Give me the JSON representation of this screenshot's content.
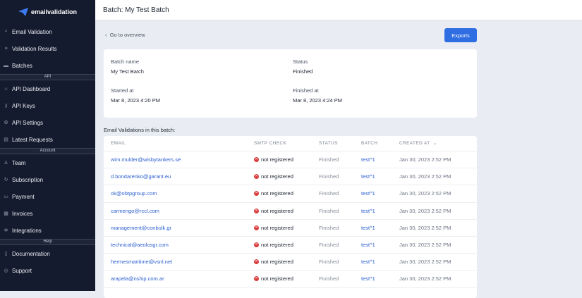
{
  "brand": "emailvalidation",
  "sidebar": {
    "items1": [
      {
        "label": "Email Validation",
        "icon": "search-icon"
      },
      {
        "label": "Validation Results",
        "icon": "list-icon"
      },
      {
        "label": "Batches",
        "icon": "batch-icon"
      }
    ],
    "section_api": "API",
    "items2": [
      {
        "label": "API Dashboard",
        "icon": "home-icon"
      },
      {
        "label": "API Keys",
        "icon": "key-icon"
      },
      {
        "label": "API Settings",
        "icon": "gear-icon"
      },
      {
        "label": "Latest Requests",
        "icon": "inbox-icon"
      }
    ],
    "section_account": "Account",
    "items3": [
      {
        "label": "Team",
        "icon": "team-icon"
      },
      {
        "label": "Subscription",
        "icon": "refresh-icon"
      },
      {
        "label": "Payment",
        "icon": "card-icon"
      },
      {
        "label": "Invoices",
        "icon": "document-icon"
      },
      {
        "label": "Integrations",
        "icon": "puzzle-icon"
      }
    ],
    "section_help": "Help",
    "items4": [
      {
        "label": "Documentation",
        "icon": "book-icon"
      },
      {
        "label": "Support",
        "icon": "lifebuoy-icon"
      }
    ]
  },
  "header": {
    "title": "Batch: My Test Batch"
  },
  "back_label": "Go to overview",
  "exports_label": "Exports",
  "batch": {
    "name_label": "Batch name",
    "name": "My Test Batch",
    "status_label": "Status",
    "status": "Finished",
    "started_label": "Started at",
    "started": "Mar 8, 2023 4:20 PM",
    "finished_label": "Finished at",
    "finished": "Mar 8, 2023 4:24 PM"
  },
  "table": {
    "title": "Email Validations in this batch:",
    "headers": [
      "EMAIL",
      "SMTP CHECK",
      "STATUS",
      "BATCH",
      "CREATED AT"
    ],
    "rows": [
      {
        "email": "wim.mulder@wisbytankers.se",
        "smtp": "not registered",
        "status": "Finished",
        "batch": "test^1",
        "created": "Jan 30, 2023 2:52 PM"
      },
      {
        "email": "d.bondarenko@garant.eu",
        "smtp": "not registered",
        "status": "Finished",
        "batch": "test^1",
        "created": "Jan 30, 2023 2:52 PM"
      },
      {
        "email": "ok@obtpgroup.com",
        "smtp": "not registered",
        "status": "Finished",
        "batch": "test^1",
        "created": "Jan 30, 2023 2:52 PM"
      },
      {
        "email": "carmengo@rccl.com",
        "smtp": "not registered",
        "status": "Finished",
        "batch": "test^1",
        "created": "Jan 30, 2023 2:52 PM"
      },
      {
        "email": "management@conbulk.gr",
        "smtp": "not registered",
        "status": "Finished",
        "batch": "test^1",
        "created": "Jan 30, 2023 2:52 PM"
      },
      {
        "email": "technical@aeolosgr.com",
        "smtp": "not registered",
        "status": "Finished",
        "batch": "test^1",
        "created": "Jan 30, 2023 2:52 PM"
      },
      {
        "email": "hermesmaritime@vsnl.net",
        "smtp": "not registered",
        "status": "Finished",
        "batch": "test^1",
        "created": "Jan 30, 2023 2:52 PM"
      },
      {
        "email": "arapela@nship.com.ar",
        "smtp": "not registered",
        "status": "Finished",
        "batch": "test^1",
        "created": "Jan 30, 2023 2:52 PM"
      }
    ]
  }
}
